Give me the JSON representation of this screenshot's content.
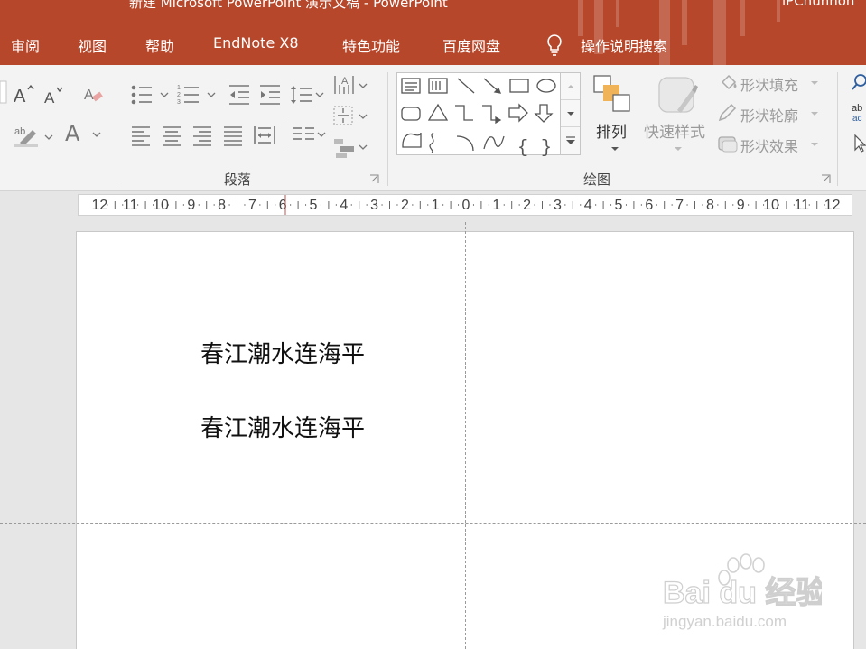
{
  "window": {
    "title": "新建 Microsoft PowerPoint 演示文稿  -  PowerPoint",
    "user": "lPChunhon"
  },
  "tabs": [
    "审阅",
    "视图",
    "帮助",
    "EndNote X8",
    "特色功能",
    "百度网盘",
    "操作说明搜索"
  ],
  "ribbon": {
    "paragraph_group": "段落",
    "drawing_group": "绘图",
    "arrange_label": "排列",
    "quick_styles_label": "快速样式",
    "shape_fill_label": "形状填充",
    "shape_outline_label": "形状轮廓",
    "shape_effects_label": "形状效果",
    "text_letter_a": "A"
  },
  "ruler": {
    "labels": [
      "12",
      "11",
      "10",
      "9",
      "8",
      "7",
      "6",
      "5",
      "4",
      "3",
      "2",
      "1",
      "0",
      "1",
      "2",
      "3",
      "4",
      "5",
      "6",
      "7",
      "8",
      "9",
      "10",
      "11",
      "12"
    ]
  },
  "slide": {
    "line1": "春江潮水连海平",
    "line2": "春江潮水连海平"
  },
  "watermark": {
    "brand": "Bai du 经验",
    "url": "jingyan.baidu.com"
  },
  "colors": {
    "accent": "#b7472a",
    "ribbon_bg": "#f3f3f3",
    "workspace_bg": "#e6e6e6"
  }
}
